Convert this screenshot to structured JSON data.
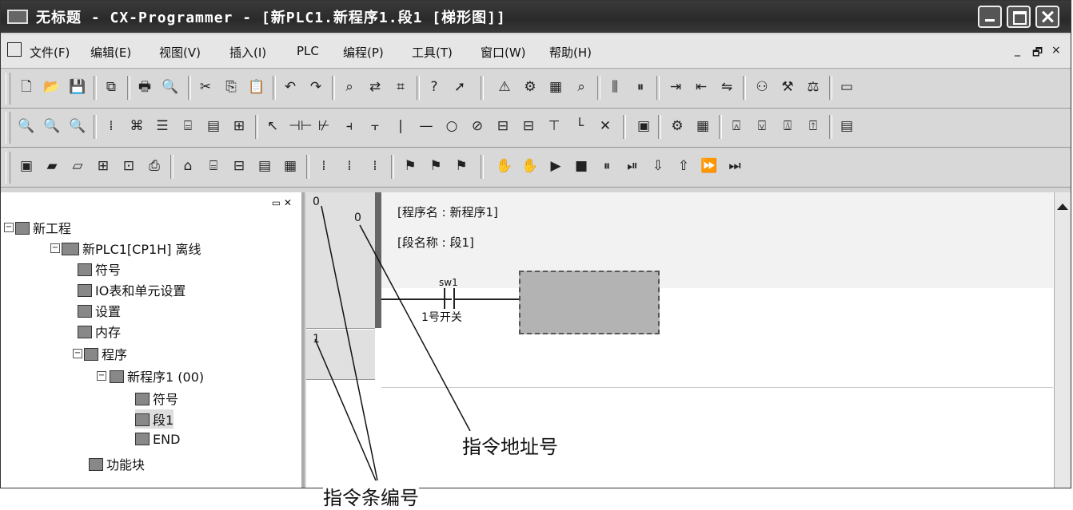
{
  "window": {
    "title": "无标题 - CX-Programmer - [新PLC1.新程序1.段1 [梯形图]]"
  },
  "menu": {
    "items": [
      "文件(F)",
      "编辑(E)",
      "视图(V)",
      "插入(I)",
      "PLC",
      "编程(P)",
      "工具(T)",
      "窗口(W)",
      "帮助(H)"
    ],
    "mdi_min": "_",
    "mdi_restore": "🗗",
    "mdi_close": "×"
  },
  "tree": {
    "root": "新工程",
    "plc": "新PLC1[CP1H] 离线",
    "symbols": "符号",
    "io_table": "IO表和单元设置",
    "settings": "设置",
    "memory": "内存",
    "programs": "程序",
    "program1": "新程序1 (00)",
    "program1_symbols": "符号",
    "section1": "段1",
    "end": "END",
    "function_blocks": "功能块"
  },
  "editor": {
    "row0_number": "0",
    "row0_address": "0",
    "program_name_label": "[程序名 : 新程序1]",
    "section_name_label": "[段名称 : 段1]",
    "contact_symbol": "sw1",
    "contact_comment": "1号开关",
    "row1_number": "1"
  },
  "annotations": {
    "instruction_address": "指令地址号",
    "instruction_number": "指令条编号"
  },
  "colors": {
    "titlebar": "#2e2e2e",
    "selection": "#b3b3b3"
  }
}
